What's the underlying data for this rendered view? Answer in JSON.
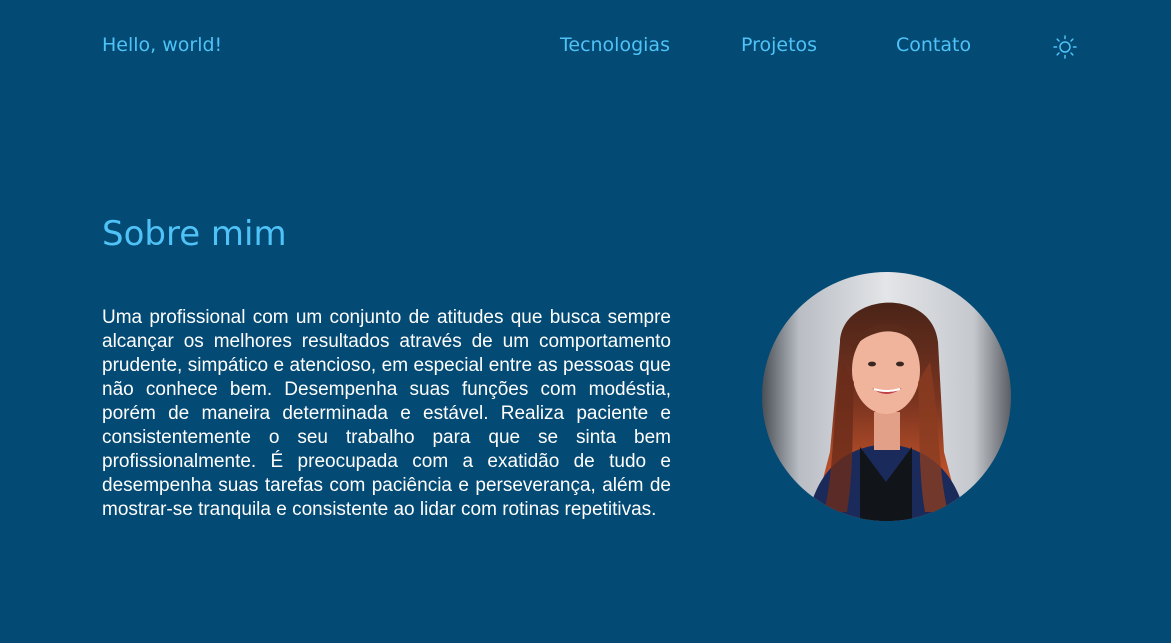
{
  "header": {
    "logo": "Hello, world!",
    "nav": [
      {
        "label": "Tecnologias"
      },
      {
        "label": "Projetos"
      },
      {
        "label": "Contato"
      }
    ],
    "theme_icon": "sun-icon"
  },
  "about": {
    "title": "Sobre mim",
    "text": "Uma profissional com um conjunto de atitudes que busca sempre alcançar os melhores resultados através de um comportamento prudente, simpático e atencioso, em especial entre as pessoas que não conhece bem. Desempenha suas funções com modéstia, porém de maneira determinada e estável. Realiza paciente e consistentemente o seu trabalho para que se sinta bem profissionalmente. É preocupada com a exatidão de tudo e desempenha suas tarefas com paciência e perseverança, além de mostrar-se tranquila e consistente ao lidar com rotinas repetitivas.",
    "photo_icon": "profile-photo"
  },
  "colors": {
    "background": "#034a74",
    "accent": "#4fc3f7",
    "text": "#ffffff"
  }
}
